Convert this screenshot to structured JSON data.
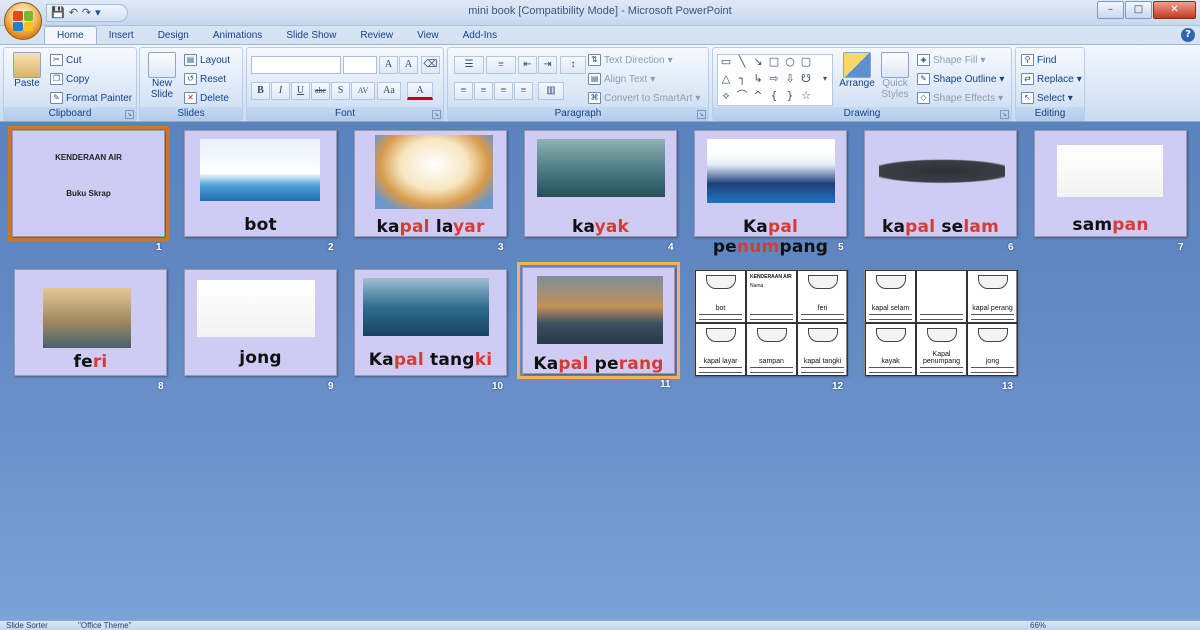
{
  "window": {
    "title": "mini book [Compatibility Mode] - Microsoft PowerPoint"
  },
  "qat": {
    "save_icon": "save-icon",
    "undo_icon": "undo-icon",
    "redo_icon": "redo-icon"
  },
  "win_controls": {
    "minimize": "–",
    "restore": "□",
    "close": "✕"
  },
  "tabs": [
    "Home",
    "Insert",
    "Design",
    "Animations",
    "Slide Show",
    "Review",
    "View",
    "Add-Ins"
  ],
  "active_tab": "Home",
  "ribbon": {
    "clipboard": {
      "label": "Clipboard",
      "paste": "Paste",
      "cut": "Cut",
      "copy": "Copy",
      "format_painter": "Format Painter"
    },
    "slides": {
      "label": "Slides",
      "new_slide": "New Slide",
      "layout": "Layout",
      "reset": "Reset",
      "delete": "Delete"
    },
    "font": {
      "label": "Font",
      "bold": "B",
      "italic": "I",
      "underline": "U",
      "strike": "abc",
      "shadow": "S",
      "spacing": "AV",
      "case": "Aa",
      "color": "A",
      "grow": "A",
      "shrink": "A"
    },
    "paragraph": {
      "label": "Paragraph",
      "text_direction": "Text Direction",
      "align_text": "Align Text",
      "convert_smartart": "Convert to SmartArt"
    },
    "drawing": {
      "label": "Drawing",
      "arrange": "Arrange",
      "quick_styles": "Quick Styles",
      "shape_fill": "Shape Fill",
      "shape_outline": "Shape Outline",
      "shape_effects": "Shape Effects"
    },
    "editing": {
      "label": "Editing",
      "find": "Find",
      "replace": "Replace",
      "select": "Select"
    }
  },
  "slides": [
    {
      "num": "1",
      "title": "KENDERAAN AIR",
      "subtitle": "Buku Skrap"
    },
    {
      "num": "2",
      "word": [
        {
          "t": "bot",
          "red": false
        }
      ]
    },
    {
      "num": "3",
      "word": [
        {
          "t": "ka",
          "red": false
        },
        {
          "t": "pal",
          "red": true
        },
        {
          "t": " la",
          "red": false
        },
        {
          "t": "yar",
          "red": true
        }
      ]
    },
    {
      "num": "4",
      "word": [
        {
          "t": "ka",
          "red": false
        },
        {
          "t": "yak",
          "red": true
        }
      ]
    },
    {
      "num": "5",
      "word": [
        {
          "t": "Ka",
          "red": false
        },
        {
          "t": "pal",
          "red": true
        },
        {
          "t": " pe",
          "red": false
        },
        {
          "t": "num",
          "red": true
        },
        {
          "t": "pang",
          "red": false
        }
      ]
    },
    {
      "num": "6",
      "word": [
        {
          "t": "ka",
          "red": false
        },
        {
          "t": "pal",
          "red": true
        },
        {
          "t": " se",
          "red": false
        },
        {
          "t": "lam",
          "red": true
        }
      ]
    },
    {
      "num": "7",
      "word": [
        {
          "t": "sam",
          "red": false
        },
        {
          "t": "pan",
          "red": true
        }
      ]
    },
    {
      "num": "8",
      "word": [
        {
          "t": "fe",
          "red": false
        },
        {
          "t": "ri",
          "red": true
        }
      ]
    },
    {
      "num": "9",
      "word": [
        {
          "t": "jong",
          "red": false
        }
      ]
    },
    {
      "num": "10",
      "word": [
        {
          "t": "Ka",
          "red": false
        },
        {
          "t": "pal",
          "red": true
        },
        {
          "t": " tang",
          "red": false
        },
        {
          "t": "ki",
          "red": true
        }
      ]
    },
    {
      "num": "11",
      "word": [
        {
          "t": "Ka",
          "red": false
        },
        {
          "t": "pal",
          "red": true
        },
        {
          "t": " pe",
          "red": false
        },
        {
          "t": "rang",
          "red": true
        }
      ]
    },
    {
      "num": "12",
      "cells": [
        "bot",
        "KENDERAAN AIR",
        "feri",
        "kapal layar",
        "sampan",
        "kapal tangki"
      ],
      "name_label": "Nama"
    },
    {
      "num": "13",
      "cells": [
        "kapal selam",
        "",
        "kapal perang",
        "kayak",
        "Kapal penumpang",
        "jong"
      ]
    }
  ],
  "selected_slide": "11",
  "statusbar": {
    "view": "Slide Sorter",
    "theme": "\"Office Theme\"",
    "zoom": "66%"
  }
}
